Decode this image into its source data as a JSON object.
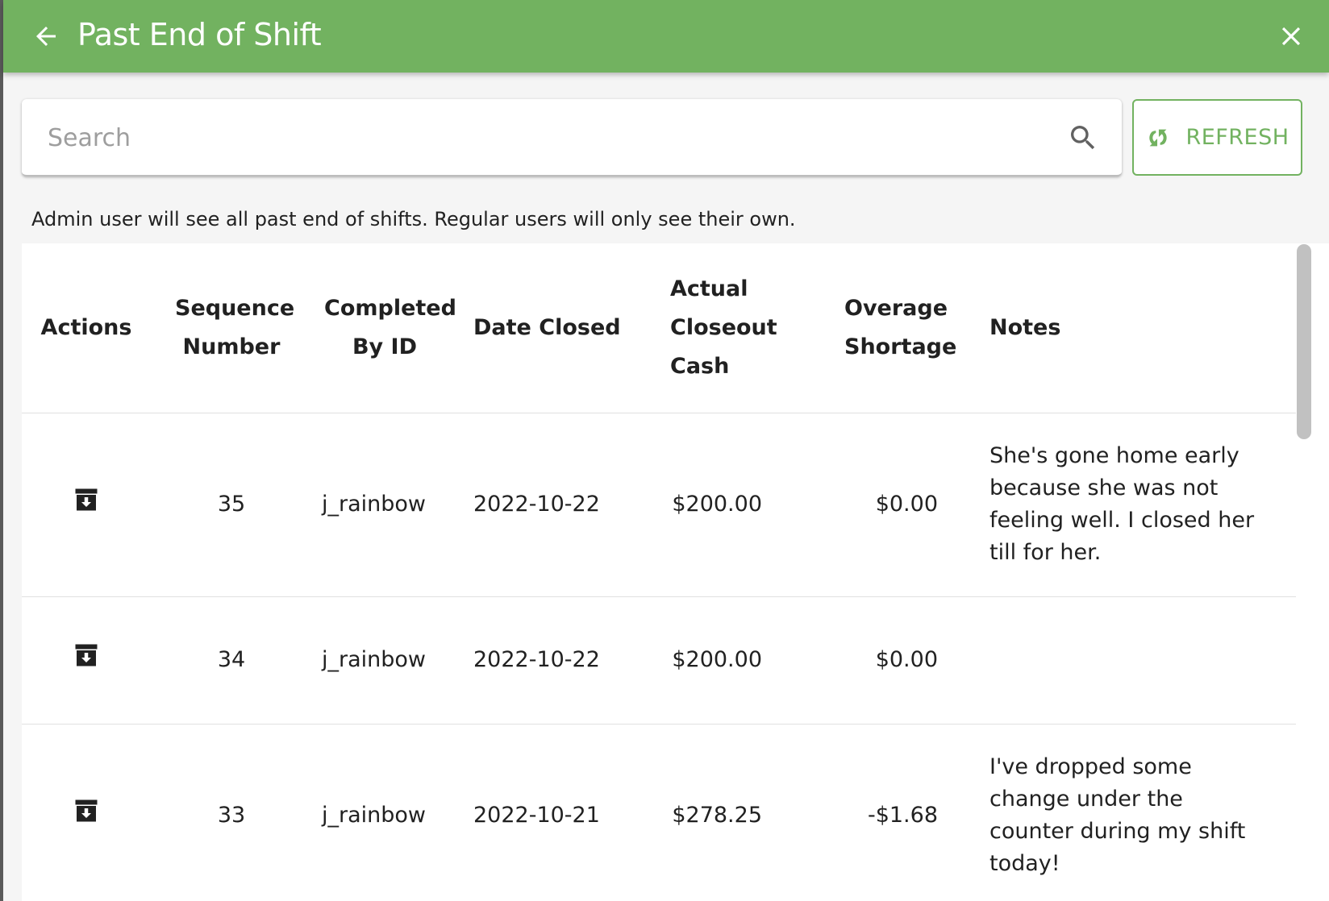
{
  "header": {
    "title": "Past End of Shift",
    "back_icon": "arrow-left-icon",
    "close_icon": "close-icon",
    "background_color": "#72b260"
  },
  "search": {
    "placeholder": "Search",
    "value": "",
    "icon": "search-icon"
  },
  "refresh": {
    "label": "REFRESH",
    "icon": "refresh-icon",
    "color": "#72b260"
  },
  "info_text": "Admin user will see all past end of shifts. Regular users will only see their own.",
  "table": {
    "columns": {
      "actions": "Actions",
      "sequence_number": "Sequence Number",
      "completed_by_id": "Completed By ID",
      "date_closed": "Date Closed",
      "actual_closeout_cash": "Actual Closeout Cash",
      "overage_shortage": "Overage Shortage",
      "notes": "Notes"
    },
    "rows": [
      {
        "action_icon": "archive-download-icon",
        "sequence_number": "35",
        "completed_by_id": "j_rainbow",
        "date_closed": "2022-10-22",
        "actual_closeout_cash": "$200.00",
        "overage_shortage": "$0.00",
        "notes": "She's gone home early because she was not feeling well. I closed her till for her."
      },
      {
        "action_icon": "archive-download-icon",
        "sequence_number": "34",
        "completed_by_id": "j_rainbow",
        "date_closed": "2022-10-22",
        "actual_closeout_cash": "$200.00",
        "overage_shortage": "$0.00",
        "notes": ""
      },
      {
        "action_icon": "archive-download-icon",
        "sequence_number": "33",
        "completed_by_id": "j_rainbow",
        "date_closed": "2022-10-21",
        "actual_closeout_cash": "$278.25",
        "overage_shortage": "-$1.68",
        "notes": "I've dropped some change under the counter during my shift today!"
      }
    ]
  }
}
